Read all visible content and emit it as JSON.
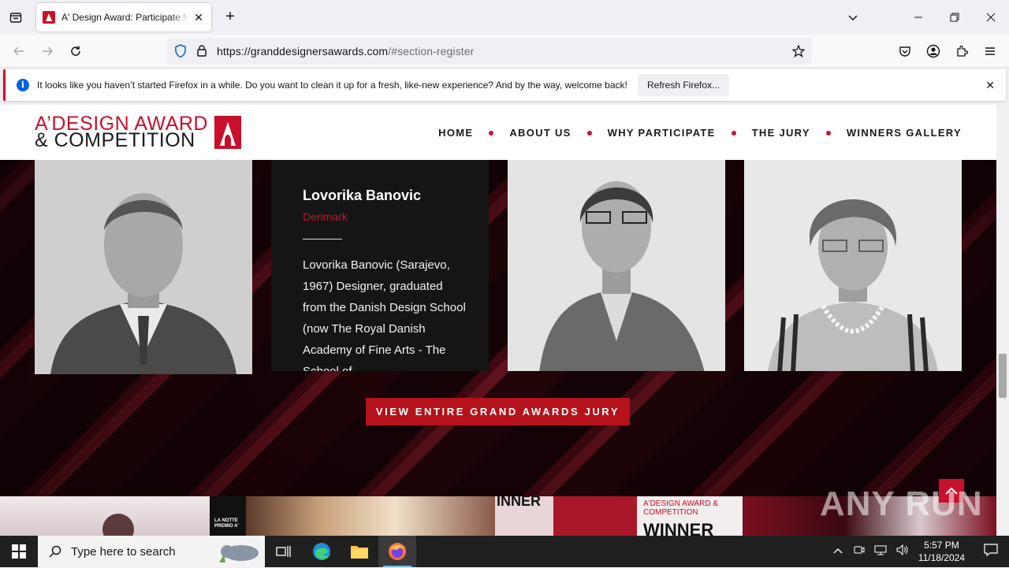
{
  "browser": {
    "tab_title": "A' Design Award: Participate for",
    "url_host": "https://granddesignersawards.com",
    "url_path": "/#section-register",
    "notification_text": "It looks like you haven’t started Firefox in a while. Do you want to clean it up for a fresh, like-new experience? And by the way, welcome back!",
    "notification_button": "Refresh Firefox..."
  },
  "site": {
    "logo_line1": "A’DESIGN AWARD",
    "logo_line2": "& COMPETITION",
    "menu": [
      "HOME",
      "ABOUT US",
      "WHY PARTICIPATE",
      "THE JURY",
      "WINNERS GALLERY"
    ]
  },
  "jury": {
    "featured_name": "Lovorika Banovic",
    "featured_country": "Denmark",
    "featured_bio": "Lovorika Banovic (Sarajevo, 1967) Designer, graduated from the Danish Design School (now The Royal Danish Academy of Fine Arts - The School of",
    "cta": "VIEW ENTIRE GRAND AWARDS JURY"
  },
  "gallery_strip": {
    "caption_1": "LA NOTTE PREMIO A'",
    "caption_2": "INNER",
    "caption_3": "A'DESIGN AWARD & COMPETITION",
    "caption_4": "WINNER"
  },
  "watermark": "ANY RUN",
  "taskbar": {
    "search_placeholder": "Type here to search",
    "time": "5:57 PM",
    "date": "11/18/2024"
  },
  "colors": {
    "brand_red": "#c8102e",
    "cta_red": "#b5121b",
    "firefox_blue": "#0060df"
  }
}
